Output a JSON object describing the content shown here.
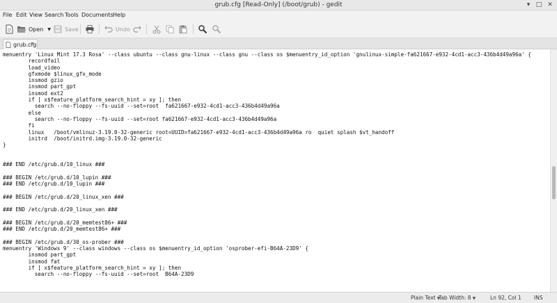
{
  "window": {
    "title": "grub.cfg [Read-Only] (/boot/grub) - gedit",
    "minimize": "▾",
    "maximize": "□",
    "close": "✕"
  },
  "menubar": [
    "File",
    "Edit",
    "View",
    "Search",
    "Tools",
    "Documents",
    "Help"
  ],
  "toolbar": {
    "open_label": "Open",
    "save_label": "Save",
    "undo_label": "Undo"
  },
  "tab": {
    "label": "grub.cfg",
    "close": "✕"
  },
  "editor": {
    "text": "menuentry 'Linux Mint 17.3 Rosa' --class ubuntu --class gnu-linux --class gnu --class os $menuentry_id_option 'gnulinux-simple-fa621667-e932-4cd1-acc3-436b4d49a96a' {\n        recordfail\n        load_video\n        gfxmode $linux_gfx_mode\n        insmod gzio\n        insmod part_gpt\n        insmod ext2\n        if [ x$feature_platform_search_hint = xy ]; then\n          search --no-floppy --fs-uuid --set=root  fa621667-e932-4cd1-acc3-436b4d49a96a\n        else\n          search --no-floppy --fs-uuid --set=root fa621667-e932-4cd1-acc3-436b4d49a96a\n        fi\n        linux   /boot/vmlinuz-3.19.0-32-generic root=UUID=fa621667-e932-4cd1-acc3-436b4d49a96a ro  quiet splash $vt_handoff\n        initrd  /boot/initrd.img-3.19.0-32-generic\n}\n\n\n### END /etc/grub.d/10_linux ###\n\n### BEGIN /etc/grub.d/10_lupin ###\n### END /etc/grub.d/10_lupin ###\n\n### BEGIN /etc/grub.d/20_linux_xen ###\n\n### END /etc/grub.d/20_linux_xen ###\n\n### BEGIN /etc/grub.d/20_memtest86+ ###\n### END /etc/grub.d/20_memtest86+ ###\n\n### BEGIN /etc/grub.d/30_os-prober ###\nmenuentry 'Windows 9' --class windows --class os $menuentry_id_option 'osprober-efi-B64A-23D9' {\n        insmod part_gpt\n        insmod fat\n        if [ x$feature_platform_search_hint = xy ]; then\n          search --no-floppy --fs-uuid --set=root  B64A-23D9"
  },
  "statusbar": {
    "language": "Plain Text",
    "tab_width": "Tab Width: 8",
    "position": "Ln 92, Col 1",
    "mode": "INS"
  }
}
